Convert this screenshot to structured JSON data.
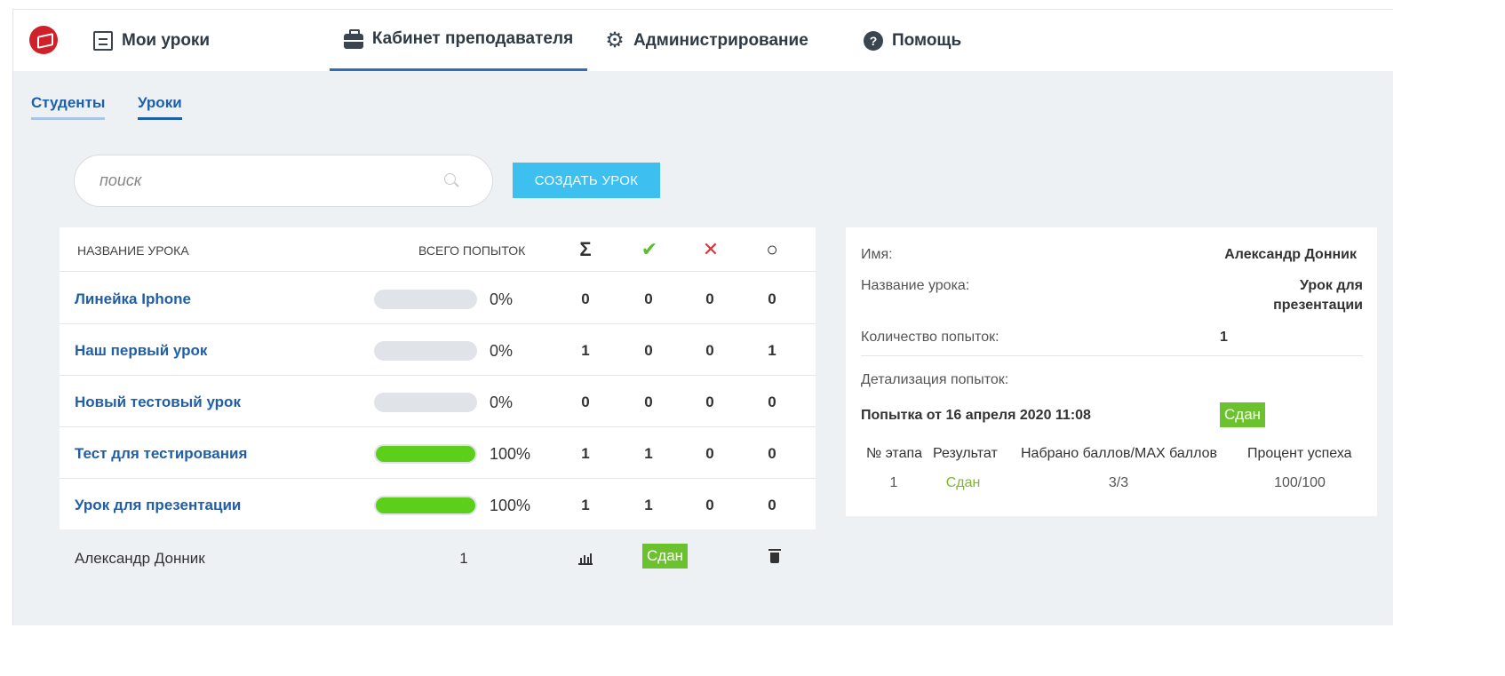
{
  "nav": {
    "tabs": [
      {
        "label": "Мои уроки",
        "icon": "document-icon"
      },
      {
        "label": "Кабинет преподавателя",
        "icon": "briefcase-icon"
      },
      {
        "label": "Администрирование",
        "icon": "gear-icon"
      },
      {
        "label": "Помощь",
        "icon": "help-icon"
      }
    ],
    "active_tab": "Кабинет преподавателя"
  },
  "subtabs": [
    "Студенты",
    "Уроки"
  ],
  "active_subtab": "Уроки",
  "search": {
    "placeholder": "поиск"
  },
  "create_button": "СОЗДАТЬ УРОК",
  "table": {
    "headers": {
      "name": "НАЗВАНИЕ УРОКА",
      "attempts": "ВСЕГО ПОПЫТОК",
      "sum_icon": "Σ",
      "passed_icon": "✔",
      "failed_icon": "✕",
      "pending_icon": "○"
    },
    "rows": [
      {
        "name": "Линейка Iphone",
        "progress": 0,
        "progress_label": "0%",
        "sum": "0",
        "passed": "0",
        "failed": "0",
        "pending": "0"
      },
      {
        "name": "Наш первый урок",
        "progress": 0,
        "progress_label": "0%",
        "sum": "1",
        "passed": "0",
        "failed": "0",
        "pending": "1"
      },
      {
        "name": "Новый тестовый урок",
        "progress": 0,
        "progress_label": "0%",
        "sum": "0",
        "passed": "0",
        "failed": "0",
        "pending": "0"
      },
      {
        "name": "Тест для тестирования",
        "progress": 100,
        "progress_label": "100%",
        "sum": "1",
        "passed": "1",
        "failed": "0",
        "pending": "0"
      },
      {
        "name": "Урок для презентации",
        "progress": 100,
        "progress_label": "100%",
        "sum": "1",
        "passed": "1",
        "failed": "0",
        "pending": "0"
      }
    ],
    "detail": {
      "student": "Александр Донник",
      "attempts": "1",
      "status": "Сдан"
    }
  },
  "panel": {
    "name_label": "Имя:",
    "name_value": "Александр Донник",
    "lesson_label": "Название урока:",
    "lesson_value_line1": "Урок для",
    "lesson_value_line2": "презентации",
    "attempts_label": "Количество попыток:",
    "attempts_value": "1",
    "details_label": "Детализация попыток:",
    "attempt_title": "Попытка от 16 апреля 2020 11:08",
    "attempt_status": "Сдан",
    "columns": [
      "№ этапа",
      "Результат",
      "Набрано баллов/MAX баллов",
      "Процент успеха"
    ],
    "rows": [
      {
        "stage": "1",
        "result": "Сдан",
        "score": "3/3",
        "percent": "100/100"
      }
    ]
  },
  "colors": {
    "accent": "#1f5fa8",
    "button": "#3dbfef",
    "success": "#5ccf1a",
    "badge": "#6cc12f",
    "danger": "#d0202a"
  }
}
